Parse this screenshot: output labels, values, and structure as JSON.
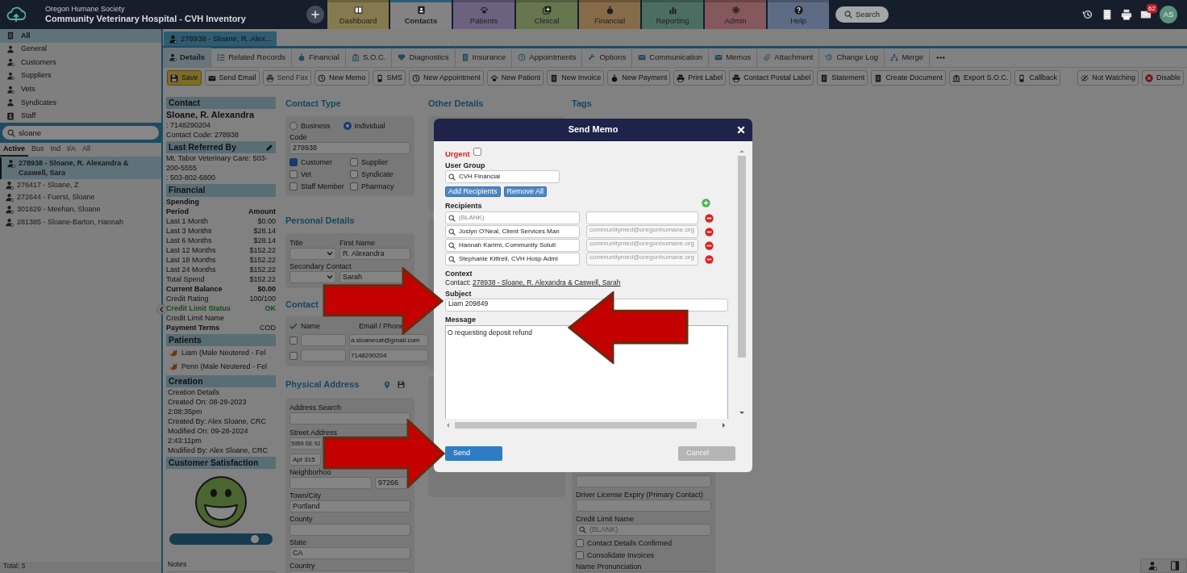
{
  "header": {
    "org": "Oregon Humane Society",
    "title": "Community Veterinary Hospital - CVH Inventory",
    "modules": [
      {
        "label": "Dashboard",
        "color": "#857a4d",
        "selected": false
      },
      {
        "label": "Contacts",
        "color": "#838383",
        "selected": true
      },
      {
        "label": "Patients",
        "color": "#6b6280",
        "selected": false
      },
      {
        "label": "Clinical",
        "color": "#66764f",
        "selected": false
      },
      {
        "label": "Financial",
        "color": "#866b48",
        "selected": false
      },
      {
        "label": "Reporting",
        "color": "#4c6e62",
        "selected": false
      },
      {
        "label": "Admin",
        "color": "#85585b",
        "selected": false
      },
      {
        "label": "Help",
        "color": "#5d6b84",
        "selected": false
      }
    ],
    "search": "Search",
    "mail_badge": "62",
    "avatar": "AS"
  },
  "sidebar": {
    "categories": [
      {
        "label": "All",
        "selected": true
      },
      {
        "label": "General",
        "selected": false
      },
      {
        "label": "Customers",
        "selected": false
      },
      {
        "label": "Suppliers",
        "selected": false
      },
      {
        "label": "Vets",
        "selected": false
      },
      {
        "label": "Syndicates",
        "selected": false
      },
      {
        "label": "Staff",
        "selected": false
      }
    ],
    "search": {
      "value": "sloane"
    },
    "filters": [
      {
        "label": "Active",
        "selected": true
      },
      {
        "label": "Bus",
        "selected": false
      },
      {
        "label": "Ind",
        "selected": false
      },
      {
        "label": "I/A",
        "selected": false
      },
      {
        "label": "All",
        "selected": false
      }
    ],
    "results": [
      {
        "label": "278938 - Sloane, R. Alexandra & Caswell, Sara",
        "selected": true
      },
      {
        "label": "276417 - Sloane, Z",
        "selected": false
      },
      {
        "label": "272644 - Fuerst, Sloane",
        "selected": false
      },
      {
        "label": "301829 - Meehan, Sloane",
        "selected": false
      },
      {
        "label": "281385 - Sloane-Barton, Hannah",
        "selected": false
      }
    ],
    "total": "Total: 5"
  },
  "record_tab": "278938 - Sloane, R. Alex...",
  "subtabs": [
    {
      "label": "Details",
      "selected": true
    },
    {
      "label": "Related Records",
      "selected": false
    },
    {
      "label": "Financial",
      "selected": false
    },
    {
      "label": "S.O.C.",
      "selected": false
    },
    {
      "label": "Diagnostics",
      "selected": false
    },
    {
      "label": "Insurance",
      "selected": false
    },
    {
      "label": "Appointments",
      "selected": false
    },
    {
      "label": "Options",
      "selected": false
    },
    {
      "label": "Communication",
      "selected": false
    },
    {
      "label": "Memos",
      "selected": false
    },
    {
      "label": "Attachment",
      "selected": false
    },
    {
      "label": "Change Log",
      "selected": false
    },
    {
      "label": "Merge",
      "selected": false
    }
  ],
  "toolbar": [
    {
      "label": "Save",
      "primary": true,
      "disabled": false
    },
    {
      "label": "Send Email",
      "primary": false,
      "disabled": false
    },
    {
      "label": "Send Fax",
      "primary": false,
      "disabled": true
    },
    {
      "label": "New Memo",
      "primary": false,
      "disabled": false
    },
    {
      "label": "SMS",
      "primary": false,
      "disabled": false
    },
    {
      "label": "New Appointment",
      "primary": false,
      "disabled": false
    },
    {
      "label": "New Patient",
      "primary": false,
      "disabled": false
    },
    {
      "label": "New Invoice",
      "primary": false,
      "disabled": false
    },
    {
      "label": "New Payment",
      "primary": false,
      "disabled": false
    },
    {
      "label": "Print Label",
      "primary": false,
      "disabled": false
    },
    {
      "label": "Contact Postal Label",
      "primary": false,
      "disabled": false
    },
    {
      "label": "Statement",
      "primary": false,
      "disabled": false
    },
    {
      "label": "Create Document",
      "primary": false,
      "disabled": false
    },
    {
      "label": "Export S.O.C.",
      "primary": false,
      "disabled": false
    },
    {
      "label": "Callback",
      "primary": false,
      "disabled": false
    }
  ],
  "toolbar_right": [
    {
      "label": "Not Watching"
    },
    {
      "label": "Disable"
    }
  ],
  "summary": {
    "contact": {
      "heading": "Contact",
      "name": "Sloane, R. Alexandra",
      "phone": ": 7148290204",
      "code": "Contact Code: 278938"
    },
    "referred": {
      "heading": "Last Referred By",
      "lines": [
        "Mt. Tabor Veterinary Care: 503-200-5555",
        ": 503-802-6800"
      ]
    },
    "financial": {
      "heading": "Financial",
      "spending": "Spending",
      "columns": [
        "Period",
        "Amount"
      ],
      "rows": [
        {
          "label": "Last 1 Month",
          "value": "$0.00",
          "kind": "normal"
        },
        {
          "label": "Last 3 Months",
          "value": "$28.14",
          "kind": "normal"
        },
        {
          "label": "Last 6 Months",
          "value": "$28.14",
          "kind": "normal"
        },
        {
          "label": "Last 12 Months",
          "value": "$152.22",
          "kind": "normal"
        },
        {
          "label": "Last 18 Months",
          "value": "$152.22",
          "kind": "normal"
        },
        {
          "label": "Last 24 Months",
          "value": "$152.22",
          "kind": "normal"
        },
        {
          "label": "Total Spend",
          "value": "$152.22",
          "kind": "normal"
        },
        {
          "label": "Current Balance",
          "value": "$0.00",
          "kind": "bold"
        },
        {
          "label": "Credit Rating",
          "value": "100/100",
          "kind": "normal"
        },
        {
          "label": "Credit Limit Status",
          "value": "OK",
          "kind": "ok"
        },
        {
          "label": "Credit Limit Name",
          "kind": "normal"
        },
        {
          "label": "Payment Terms",
          "value": "COD",
          "kind": "mixed"
        }
      ]
    },
    "patients": {
      "heading": "Patients",
      "items": [
        "Liam (Male Neutered - Fel",
        "Penn (Male Neutered - Fel"
      ]
    },
    "creation": {
      "heading": "Creation",
      "lines": [
        "Creation Details",
        "Created On: 08-29-2023 2:08:35pm",
        "Created By: Alex Sloane, CRC",
        "Modified On: 09-28-2024 2:43:11pm",
        "Modified By: Alex Sloane, CRC"
      ]
    },
    "satisfaction": {
      "heading": "Customer Satisfaction",
      "level": 0.88
    },
    "notes_label": "Notes"
  },
  "contact_type": {
    "heading": "Contact Type",
    "options": [
      {
        "label": "Business",
        "selected": false
      },
      {
        "label": "Individual",
        "selected": true
      }
    ],
    "code_label": "Code",
    "code": "278938",
    "roles": [
      {
        "label": "Customer",
        "checked": true
      },
      {
        "label": "Supplier",
        "checked": false
      },
      {
        "label": "Vet",
        "checked": false
      },
      {
        "label": "Syndicate",
        "checked": false
      },
      {
        "label": "Staff Member",
        "checked": false
      },
      {
        "label": "Pharmacy",
        "checked": false
      }
    ]
  },
  "personal_details": {
    "heading": "Personal Details",
    "title_label": "Title",
    "first_name_label": "First Name",
    "first_name": "R. Alexandra",
    "secondary_label": "Secondary Contact",
    "secondary": "Sarah"
  },
  "contact_details": {
    "heading": "Contact",
    "columns": [
      "Name",
      "Email / Phone"
    ],
    "rows": [
      {
        "checked": false,
        "value": "a.sloanecat@gmail.com"
      },
      {
        "checked": false,
        "value": "7148290204"
      }
    ]
  },
  "physical_address": {
    "heading": "Physical Address",
    "address_search_label": "Address Search",
    "street_label": "Street Address",
    "street": "5959 SE 92",
    "street2": "Apt 315",
    "neighborhood_label": "Neighborhoo",
    "zip": "97266",
    "city_label": "Town/City",
    "city": "Portland",
    "county_label": "County",
    "state_label": "State",
    "state": "CA",
    "country_label": "Country"
  },
  "other_details": {
    "heading": "Other Details"
  },
  "tags": {
    "heading": "Tags",
    "driver_label": "Driver License Expiry (Primary Contact)",
    "credit_limit_label": "Credit Limit Name",
    "credit_limit_placeholder": "(BLANK)",
    "checks": [
      {
        "label": "Contact Details Confirmed",
        "checked": false
      },
      {
        "label": "Consolidate Invoices",
        "checked": false
      }
    ],
    "pronunciation_label": "Name Pronunciation"
  },
  "memo": {
    "title": "Send Memo",
    "urgent": {
      "label": "Urgent",
      "checked": false
    },
    "user_group_label": "User Group",
    "user_group": "CVH Financial",
    "add_recipients": "Add Recipients",
    "remove_all": "Remove All",
    "recipients_label": "Recipients",
    "recipients": [
      {
        "placeholder": "(BLANK)"
      },
      {
        "name": "Joslyn O'Neal, Client Services Man",
        "email": "communitymed@oregonhumane.org"
      },
      {
        "name": "Hannah Karimi, Community Soluti",
        "email": "communitymed@oregonhumane.org"
      },
      {
        "name": "Stephanie Kittrell, CVH Hosp Admi",
        "email": "communitymed@oregonhumane.org"
      }
    ],
    "context_label": "Context",
    "context_prefix": "Contact:",
    "context_link": "278938 - Sloane, R. Alexandra & Caswell, Sarah",
    "subject_label": "Subject",
    "subject": "Liam 209849",
    "message_label": "Message",
    "message": "O requesting deposit refund",
    "send": "Send",
    "cancel": "Cancel"
  }
}
